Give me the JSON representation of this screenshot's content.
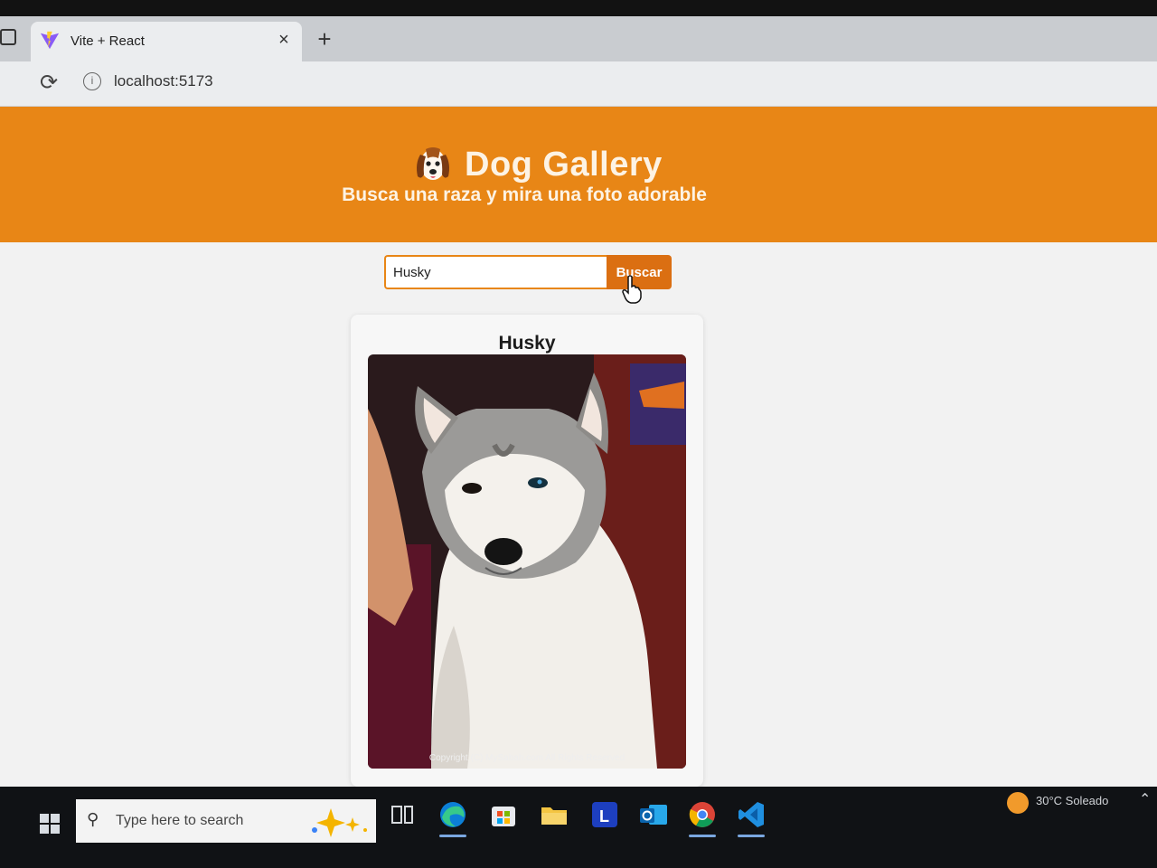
{
  "browser": {
    "tab": {
      "title": "Vite + React",
      "close": "×"
    },
    "new_tab": "+",
    "reload": "⟳",
    "site_info": "i",
    "url": "localhost:5173"
  },
  "header": {
    "title": "Dog Gallery",
    "subtitle": "Busca una raza y mira una foto adorable"
  },
  "search": {
    "value": "Husky",
    "button_label": "Buscar"
  },
  "result": {
    "breed": "Husky",
    "photo_caption": "Copyright (C) MySabah.com All Rights Reserved"
  },
  "taskbar": {
    "search_placeholder": "Type here to search",
    "search_icon": "⚲",
    "apps": [
      "task-view",
      "edge",
      "microsoft-store",
      "file-explorer",
      "l-app",
      "outlook",
      "chrome",
      "vscode"
    ],
    "weather": "30°C  Soleado",
    "tray_chevron": "⌃"
  },
  "colors": {
    "header_orange": "#e88616",
    "button_orange": "#db6f12",
    "header_text": "#fdf3e4"
  }
}
